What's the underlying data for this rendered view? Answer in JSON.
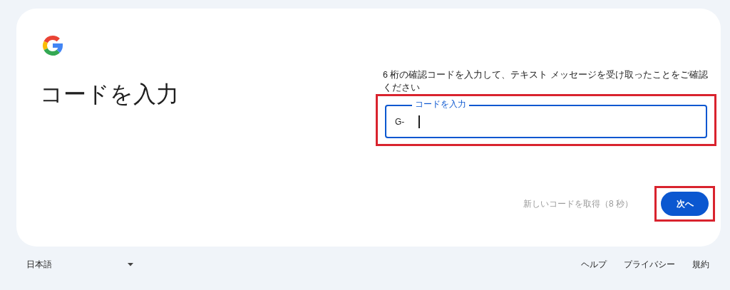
{
  "heading": "コードを入力",
  "instructions": "6 桁の確認コードを入力して、テキスト メッセージを受け取ったことをご確認ください",
  "code_field": {
    "label": "コードを入力",
    "prefix": "G-",
    "focused": true,
    "highlighted": true
  },
  "resend_link": {
    "label": "新しいコードを取得（8 秒）",
    "disabled": true
  },
  "next_button": {
    "label": "次へ",
    "highlighted": true
  },
  "footer": {
    "language": "日本語",
    "links": [
      "ヘルプ",
      "プライバシー",
      "規約"
    ]
  }
}
